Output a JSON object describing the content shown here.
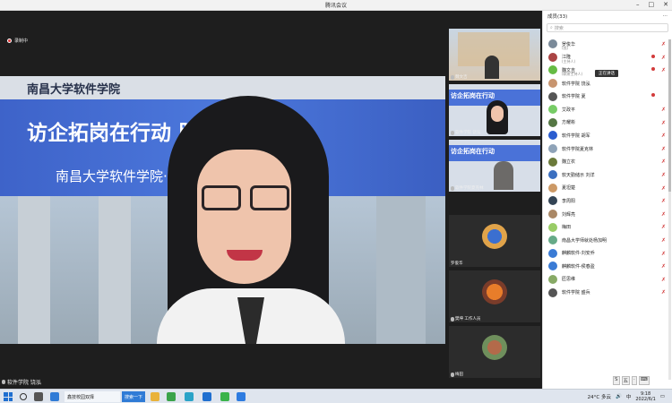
{
  "window": {
    "title": "腾讯会议",
    "minimize": "–",
    "maximize": "□",
    "close": "✕"
  },
  "recording": {
    "label": "录制中",
    "color": "#e23c3c"
  },
  "main_video": {
    "building_sign": "南昌大学软件学院",
    "banner_line1": "访企拓岗在行动  服务促就业",
    "banner_line2": "南昌大学软件学院·  ·业专项行动",
    "speaker_name": "软件学院 饶泓",
    "banner_color": "#4a72d8"
  },
  "thumbnails": [
    {
      "name": "魏文吉"
    },
    {
      "name": "软件学院 饶泓",
      "band": "访企拓岗在行动"
    },
    {
      "name": "软件学院夏克林",
      "band": "访企拓岗在行动"
    },
    {
      "name": "罗俊华"
    },
    {
      "name": "樊坤 工作人员"
    },
    {
      "name": "梅田"
    }
  ],
  "members_panel": {
    "title": "成员(33)",
    "search_placeholder": "搜索",
    "tooltip": "正在讲话",
    "members": [
      {
        "name": "罗俊华",
        "sub": "(我)",
        "color": "#7a8a99",
        "mic_off": true
      },
      {
        "name": "江隆",
        "sub": "(主持人)",
        "color": "#a44",
        "mic_off": true,
        "cam": true
      },
      {
        "name": "魏文吉",
        "sub": "(联席主持人)",
        "color": "#6b4",
        "mic_off": true,
        "cam": true
      },
      {
        "name": "软件学院 饶泓",
        "sub": "",
        "color": "#c8956f",
        "mic_off": false
      },
      {
        "name": "软件学院 夏",
        "sub": "",
        "color": "#555",
        "mic_off": false,
        "cam": true
      },
      {
        "name": "艾政平",
        "sub": "",
        "color": "#7c6",
        "mic_off": true
      },
      {
        "name": "方耀彬",
        "sub": "",
        "color": "#574",
        "mic_off": true
      },
      {
        "name": "软件学院 胡军",
        "sub": "",
        "color": "#2a5ccf",
        "mic_off": true
      },
      {
        "name": "软件学院夏克林",
        "sub": "",
        "color": "#8fa3b8",
        "mic_off": true
      },
      {
        "name": "魏立农",
        "sub": "",
        "color": "#6b7a3a",
        "mic_off": true
      },
      {
        "name": "软天勤储示 刘洋",
        "sub": "",
        "color": "#3b6fc0",
        "mic_off": true
      },
      {
        "name": "夏坦楚",
        "sub": "",
        "color": "#c96",
        "mic_off": true
      },
      {
        "name": "李周阳",
        "sub": "",
        "color": "#345",
        "mic_off": true
      },
      {
        "name": "刘辉亮",
        "sub": "",
        "color": "#a86",
        "mic_off": true
      },
      {
        "name": "梅田",
        "sub": "",
        "color": "#9c6",
        "mic_off": true
      },
      {
        "name": "南昌大学师就处杨加明",
        "sub": "",
        "color": "#6a8",
        "mic_off": true
      },
      {
        "name": "麒麟软件-刘安乔",
        "sub": "",
        "color": "#3a7bd5",
        "mic_off": true
      },
      {
        "name": "麒麟软件-侯春盈",
        "sub": "",
        "color": "#3a7bd5",
        "mic_off": true
      },
      {
        "name": "匠思维",
        "sub": "",
        "color": "#8a6",
        "mic_off": true
      },
      {
        "name": "软件学院 盛兵",
        "sub": "",
        "color": "#555",
        "mic_off": true
      }
    ]
  },
  "ime": {
    "a": "S",
    "b": "五",
    "c": "·",
    "d": "⌨"
  },
  "taskbar": {
    "search_icon": "search-icon",
    "task1": "鑫技校园双择",
    "task2": "搜索一下",
    "temp": "24°C 多云",
    "lang": "中",
    "time": "9:18",
    "date": "2022/6/1"
  }
}
